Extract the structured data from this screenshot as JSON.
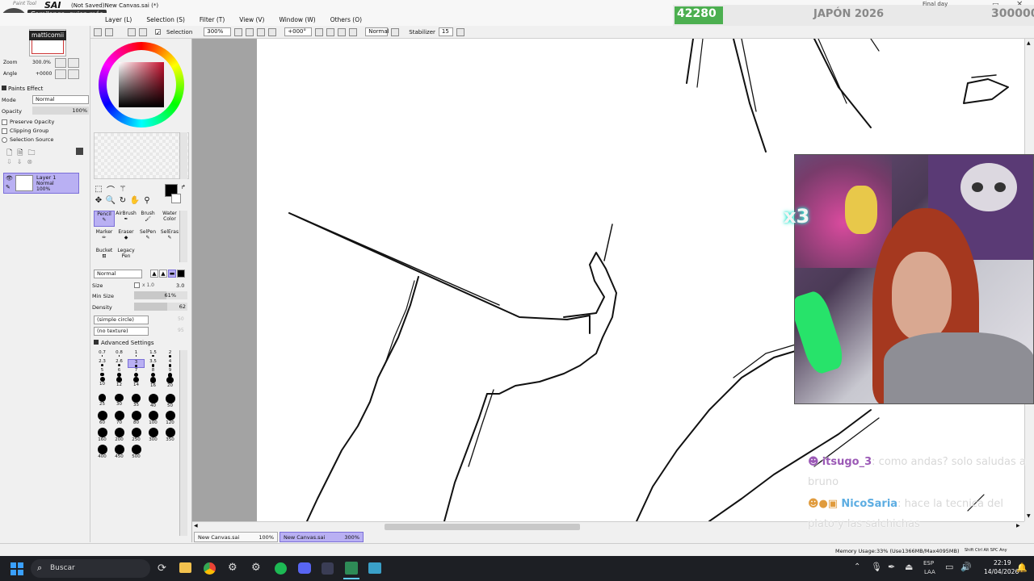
{
  "window": {
    "app_logo_text": "SAI",
    "app_logo_sub": "Paint Tool",
    "title": "(Not Saved)New Canvas.sai (*)",
    "chat_notice": "Camilanga, quien más",
    "username_badge": "matticomii"
  },
  "menu": [
    "Layer (L)",
    "Selection (S)",
    "Filter (T)",
    "View (V)",
    "Window (W)",
    "Others (O)"
  ],
  "toolbar": {
    "selection_label": "Selection",
    "zoom_value": "300%",
    "rotation_value": "+000°",
    "blend_value": "Normal",
    "stabilizer_label": "Stabilizer",
    "stabilizer_value": "15"
  },
  "navigator": {
    "zoom_label": "Zoom",
    "zoom_value": "300.0%",
    "angle_label": "Angle",
    "angle_value": "+0000"
  },
  "layer_props": {
    "paints_effect": "Paints Effect",
    "mode_label": "Mode",
    "mode_value": "Normal",
    "opacity_label": "Opacity",
    "opacity_value": "100%",
    "preserve_opacity": "Preserve Opacity",
    "clipping_group": "Clipping Group",
    "selection_source": "Selection Source"
  },
  "layers": [
    {
      "name": "Layer 1",
      "mode": "Normal",
      "opacity": "100%"
    }
  ],
  "tools": {
    "brushes": [
      {
        "label": "Pencil"
      },
      {
        "label": "AirBrush"
      },
      {
        "label": "Brush"
      },
      {
        "label": "Water Color"
      },
      {
        "label": "Marker"
      },
      {
        "label": "Eraser"
      },
      {
        "label": "SelPen"
      },
      {
        "label": "SelEras"
      },
      {
        "label": "Bucket"
      },
      {
        "label": "Legacy Pen"
      }
    ],
    "blend_mode": "Normal",
    "size_label": "Size",
    "size_mult": "x 1.0",
    "size_value": "3.0",
    "minsize_label": "Min Size",
    "minsize_value": "61%",
    "minsize_fraction": 0.61,
    "density_label": "Density",
    "density_value": "62",
    "density_fraction": 0.62,
    "shape_value": "(simple circle)",
    "shape_num": "50",
    "texture_value": "(no texture)",
    "texture_num": "95",
    "advanced_label": "Advanced Settings",
    "sizes": [
      "0.7",
      "0.8",
      "1",
      "1.5",
      "2",
      "2.3",
      "2.6",
      "3",
      "3.5",
      "4",
      "5",
      "6",
      "7",
      "8",
      "9",
      "10",
      "12",
      "14",
      "16",
      "20",
      "25",
      "30",
      "35",
      "40",
      "50",
      "60",
      "70",
      "80",
      "100",
      "120",
      "160",
      "200",
      "250",
      "300",
      "350",
      "400",
      "450",
      "500"
    ],
    "selected_size": "3"
  },
  "doc_tabs": [
    {
      "name": "New Canvas.sai",
      "zoom": "100%"
    },
    {
      "name": "New Canvas.sai",
      "zoom": "300%"
    }
  ],
  "status": {
    "memory": "Memory Usage:33% (Use1366MB/Max4095MB)",
    "keys": "Shift Ctrl Alt SPC Any"
  },
  "stream": {
    "counter": "42280",
    "event": "JAPÓN 2026",
    "goal": "300000",
    "small_label": "Final day",
    "combo": "x3",
    "chat": [
      {
        "user": "itsugo_3",
        "message": ": como andas? solo saludas a bruno"
      },
      {
        "user": "NicoSaria",
        "message": ": hace la tecnica del plato y las salchichas"
      }
    ]
  },
  "taskbar": {
    "search_placeholder": "Buscar",
    "lang_top": "ESP",
    "lang_bottom": "LAA",
    "time": "22:19",
    "date": "14/04/2026"
  },
  "colors": {
    "accent_purple": "#b9b0f3",
    "counter_green": "#4caf50",
    "chat_user1": "#9b59b6",
    "chat_user2": "#5dade2"
  }
}
